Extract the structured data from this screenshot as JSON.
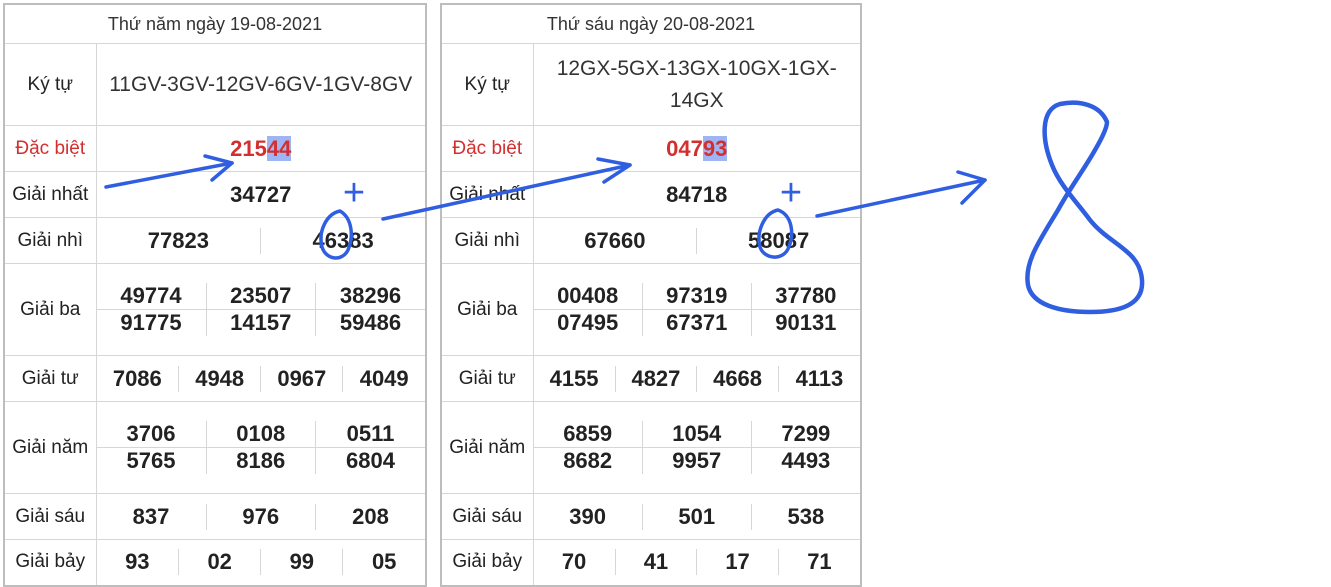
{
  "tables": [
    {
      "header": "Thứ năm ngày 19-08-2021",
      "labels": {
        "ky_tu": "Ký tự",
        "dac_biet": "Đặc biệt",
        "nhat": "Giải nhất",
        "nhi": "Giải nhì",
        "ba": "Giải ba",
        "tu": "Giải tư",
        "nam": "Giải năm",
        "sau": "Giải sáu",
        "bay": "Giải bảy"
      },
      "ky_tu": "11GV-3GV-12GV-6GV-1GV-8GV",
      "dac_biet_prefix": "215",
      "dac_biet_highlight": "44",
      "nhat": "34727",
      "nhi": [
        "77823",
        "46383"
      ],
      "ba": [
        "49774",
        "23507",
        "38296",
        "91775",
        "14157",
        "59486"
      ],
      "tu": [
        "7086",
        "4948",
        "0967",
        "4049"
      ],
      "nam": [
        "3706",
        "0108",
        "0511",
        "5765",
        "8186",
        "6804"
      ],
      "sau": [
        "837",
        "976",
        "208"
      ],
      "bay": [
        "93",
        "02",
        "99",
        "05"
      ]
    },
    {
      "header": "Thứ sáu ngày 20-08-2021",
      "labels": {
        "ky_tu": "Ký tự",
        "dac_biet": "Đặc biệt",
        "nhat": "Giải nhất",
        "nhi": "Giải nhì",
        "ba": "Giải ba",
        "tu": "Giải tư",
        "nam": "Giải năm",
        "sau": "Giải sáu",
        "bay": "Giải bảy"
      },
      "ky_tu": "12GX-5GX-13GX-10GX-1GX-14GX",
      "dac_biet_prefix": "047",
      "dac_biet_highlight": "93",
      "nhat": "84718",
      "nhi": [
        "67660",
        "58087"
      ],
      "ba": [
        "00408",
        "97319",
        "37780",
        "07495",
        "67371",
        "90131"
      ],
      "tu": [
        "4155",
        "4827",
        "4668",
        "4113"
      ],
      "nam": [
        "6859",
        "1054",
        "7299",
        "8682",
        "9957",
        "4493"
      ],
      "sau": [
        "390",
        "501",
        "538"
      ],
      "bay": [
        "70",
        "41",
        "17",
        "71"
      ]
    }
  ],
  "annotations": {
    "plus_sign": "+",
    "result_digit": "8",
    "ink_color": "#2f5fe0"
  }
}
